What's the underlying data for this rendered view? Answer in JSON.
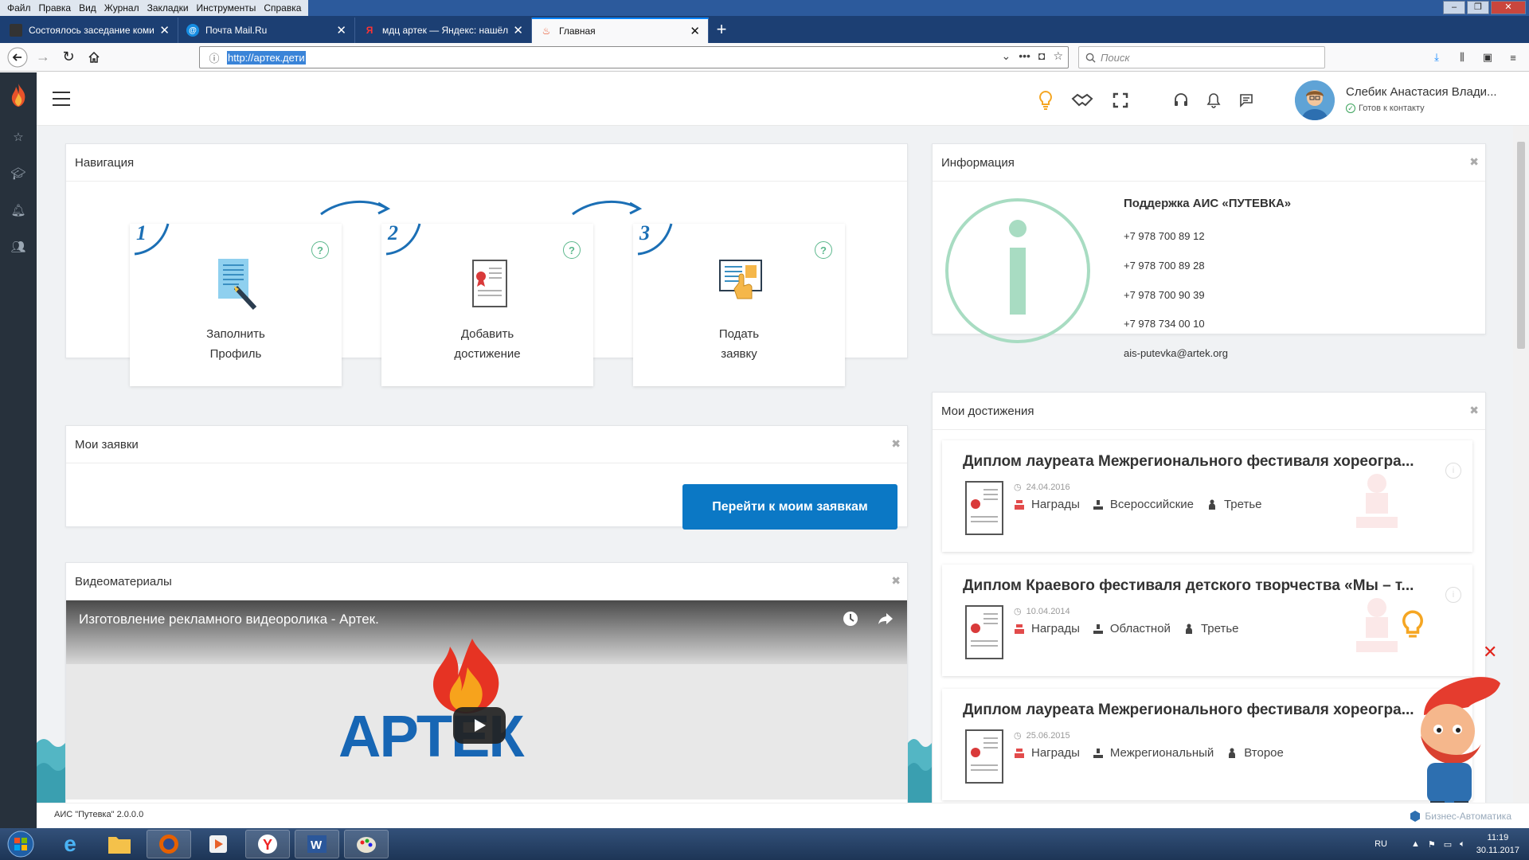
{
  "browser": {
    "menu": [
      "Файл",
      "Правка",
      "Вид",
      "Журнал",
      "Закладки",
      "Инструменты",
      "Справка"
    ],
    "tabs": [
      {
        "title": "Состоялось заседание комис",
        "active": false
      },
      {
        "title": "Почта Mail.Ru",
        "active": false
      },
      {
        "title": "мдц артек — Яндекс: нашёлся",
        "active": false
      },
      {
        "title": "Главная",
        "active": true
      }
    ],
    "url": "http://артек.дети",
    "search_placeholder": "Поиск"
  },
  "header": {
    "user_name": "Слебик Анастасия Влади...",
    "user_status": "Готов к контакту"
  },
  "navigation": {
    "title": "Навигация",
    "steps": [
      {
        "number": "1",
        "line1": "Заполнить",
        "line2": "Профиль"
      },
      {
        "number": "2",
        "line1": "Добавить",
        "line2": "достижение"
      },
      {
        "number": "3",
        "line1": "Подать",
        "line2": "заявку"
      }
    ]
  },
  "info": {
    "title": "Информация",
    "support_title": "Поддержка АИС «ПУТЕВКА»",
    "phones": [
      "+7 978 700 89 12",
      "+7 978 700 89 28",
      "+7 978 700 90 39",
      "+7 978 734 00 10"
    ],
    "email": "ais-putevka@artek.org"
  },
  "requests": {
    "title": "Мои заявки",
    "button": "Перейти к моим заявкам"
  },
  "videos": {
    "title": "Видеоматериалы",
    "video_title": "Изготовление рекламного видеоролика - Артек.",
    "logo_text": "АРТЕК"
  },
  "achievements": {
    "title": "Мои достижения",
    "items": [
      {
        "title": "Диплом лауреата Межрегионального фестиваля хореогра...",
        "date": "24.04.2016",
        "type": "Награды",
        "level": "Всероссийские",
        "place": "Третье"
      },
      {
        "title": "Диплом Краевого фестиваля детского творчества «Мы – т...",
        "date": "10.04.2014",
        "type": "Награды",
        "level": "Областной",
        "place": "Третье"
      },
      {
        "title": "Диплом лауреата Межрегионального фестиваля хореогра...",
        "date": "25.06.2015",
        "type": "Награды",
        "level": "Межрегиональный",
        "place": "Второе"
      }
    ]
  },
  "footer": {
    "version": "АИС \"Путевка\" 2.0.0.0",
    "brand": "Бизнес-Автоматика"
  },
  "taskbar": {
    "lang": "RU",
    "time": "11:19",
    "date": "30.11.2017"
  },
  "colors": {
    "primary_button": "#0b78c5",
    "step_number": "#1b6fb5",
    "info_icon": "#a8dcc2",
    "award_red": "#e24b4b",
    "sidebar": "#27313c"
  }
}
